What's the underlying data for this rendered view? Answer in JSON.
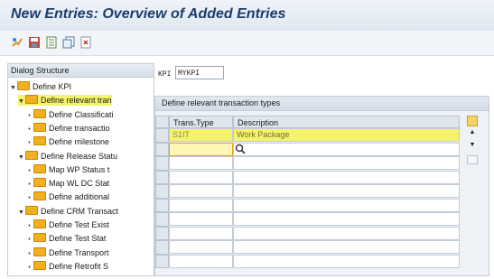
{
  "window": {
    "title": "New Entries: Overview of Added Entries"
  },
  "toolbar": {
    "icons": [
      "display-change-icon",
      "save-icon",
      "new-entries-icon",
      "copy-icon",
      "delete-icon"
    ]
  },
  "tree": {
    "header": "Dialog Structure",
    "nodes": [
      {
        "label": "Define KPI",
        "level": 0,
        "toggle": "▼"
      },
      {
        "label": "Define relevant tran",
        "level": 1,
        "toggle": "▼",
        "selected": true
      },
      {
        "label": "Define Classificati",
        "level": 2,
        "toggle": "•"
      },
      {
        "label": "Define transactio",
        "level": 2,
        "toggle": "•"
      },
      {
        "label": "Define milestone",
        "level": 2,
        "toggle": "•"
      },
      {
        "label": "Define Release Statu",
        "level": 1,
        "toggle": "▼"
      },
      {
        "label": "Map WP Status t",
        "level": 2,
        "toggle": "•"
      },
      {
        "label": "Map WL DC Stat",
        "level": 2,
        "toggle": "•"
      },
      {
        "label": "Define additional",
        "level": 2,
        "toggle": "•"
      },
      {
        "label": "Define CRM Transact",
        "level": 1,
        "toggle": "▼"
      },
      {
        "label": "Define Test Exist",
        "level": 2,
        "toggle": "•"
      },
      {
        "label": "Define Test Stat",
        "level": 2,
        "toggle": "•"
      },
      {
        "label": "Define Transport",
        "level": 2,
        "toggle": "•"
      },
      {
        "label": "Define Retrofit S",
        "level": 2,
        "toggle": "•"
      }
    ]
  },
  "kpi": {
    "label": "KPI",
    "value": "MYKPI"
  },
  "panel": {
    "title": "Define relevant transaction types",
    "columns": [
      "Trans.Type",
      "Description"
    ],
    "rows": [
      {
        "type": "S1IT",
        "description": "Work Package",
        "highlight": true
      },
      {
        "type": "",
        "description": "",
        "active": true
      }
    ],
    "empty_rows": 8
  },
  "colors": {
    "highlight": "#f5f36b",
    "title": "#1c3c6b",
    "folder": "#f2b01e"
  }
}
